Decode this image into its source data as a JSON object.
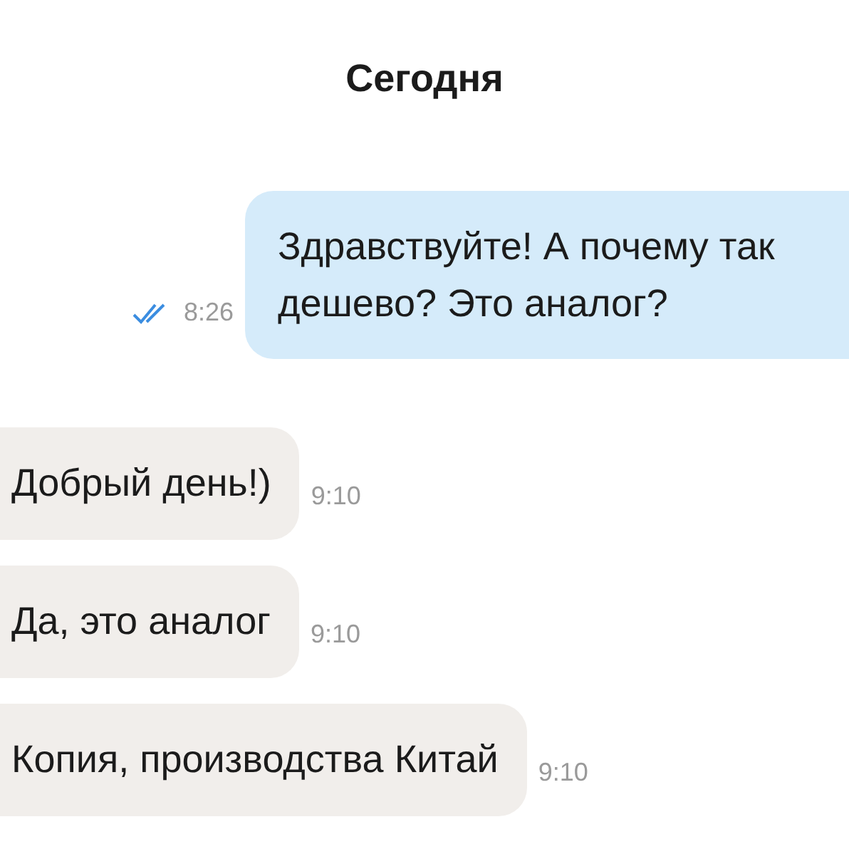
{
  "date_header": "Сегодня",
  "messages": [
    {
      "kind": "outgoing",
      "text": "Здравствуйте! А почему так дешево? Это аналог?",
      "time": "8:26",
      "read": true
    },
    {
      "kind": "incoming",
      "text": "Добрый день!)",
      "time": "9:10"
    },
    {
      "kind": "incoming",
      "text": "Да, это аналог",
      "time": "9:10"
    },
    {
      "kind": "incoming",
      "text": "Копия, производства Китай",
      "time": "9:10"
    }
  ]
}
